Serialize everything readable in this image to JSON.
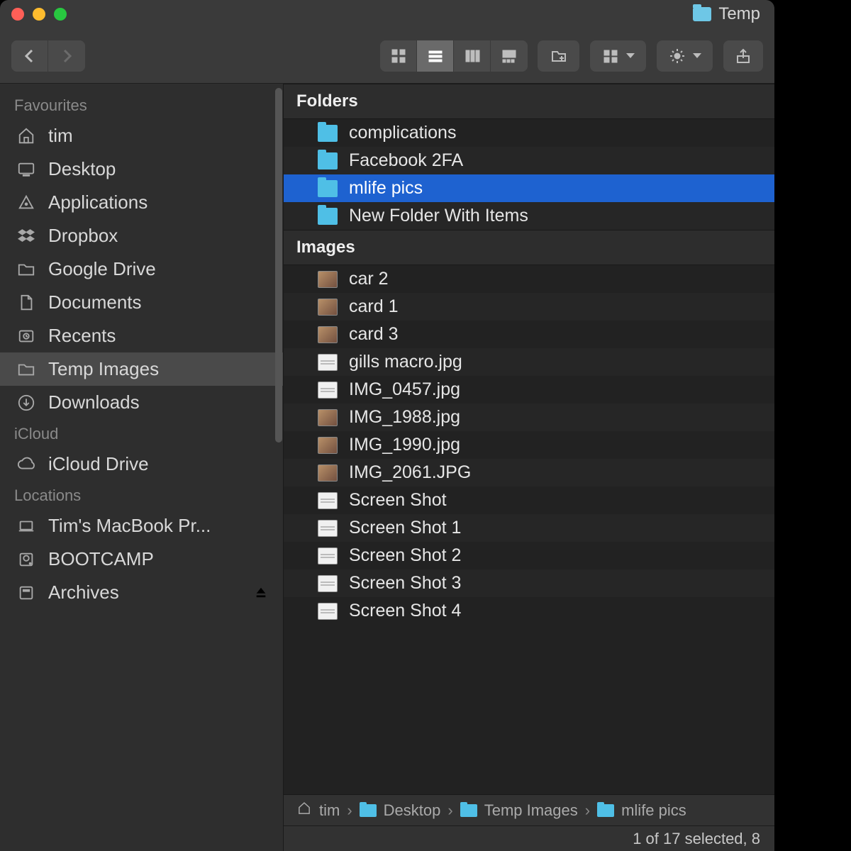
{
  "title": {
    "folder_name": "Temp"
  },
  "sidebar": {
    "sections": [
      {
        "header": "Favourites",
        "items": [
          {
            "label": "tim",
            "icon": "home"
          },
          {
            "label": "Desktop",
            "icon": "desktop"
          },
          {
            "label": "Applications",
            "icon": "apps"
          },
          {
            "label": "Dropbox",
            "icon": "dropbox"
          },
          {
            "label": "Google Drive",
            "icon": "folder"
          },
          {
            "label": "Documents",
            "icon": "document"
          },
          {
            "label": "Recents",
            "icon": "recents"
          },
          {
            "label": "Temp Images",
            "icon": "folder",
            "selected": true
          },
          {
            "label": "Downloads",
            "icon": "downloads"
          }
        ]
      },
      {
        "header": "iCloud",
        "items": [
          {
            "label": "iCloud Drive",
            "icon": "cloud"
          }
        ]
      },
      {
        "header": "Locations",
        "items": [
          {
            "label": "Tim's MacBook Pr...",
            "icon": "laptop"
          },
          {
            "label": "BOOTCAMP",
            "icon": "hdd"
          },
          {
            "label": "Archives",
            "icon": "ext",
            "eject": true
          }
        ]
      }
    ]
  },
  "main": {
    "groups": [
      {
        "header": "Folders",
        "rows": [
          {
            "name": "complications",
            "kind": "folder"
          },
          {
            "name": "Facebook 2FA",
            "kind": "folder"
          },
          {
            "name": "mlife pics",
            "kind": "folder",
            "selected": true
          },
          {
            "name": "New Folder With Items",
            "kind": "folder"
          }
        ]
      },
      {
        "header": "Images",
        "rows": [
          {
            "name": "car 2",
            "kind": "img"
          },
          {
            "name": "card 1",
            "kind": "img"
          },
          {
            "name": "card 3",
            "kind": "img"
          },
          {
            "name": "gills macro.jpg",
            "kind": "white"
          },
          {
            "name": "IMG_0457.jpg",
            "kind": "white"
          },
          {
            "name": "IMG_1988.jpg",
            "kind": "img"
          },
          {
            "name": "IMG_1990.jpg",
            "kind": "img"
          },
          {
            "name": "IMG_2061.JPG",
            "kind": "img"
          },
          {
            "name": "Screen Shot",
            "kind": "white"
          },
          {
            "name": "Screen Shot 1",
            "kind": "white"
          },
          {
            "name": "Screen Shot 2",
            "kind": "white"
          },
          {
            "name": "Screen Shot 3",
            "kind": "white"
          },
          {
            "name": "Screen Shot 4",
            "kind": "white"
          }
        ]
      }
    ]
  },
  "pathbar": {
    "segments": [
      {
        "label": "tim",
        "icon": "home"
      },
      {
        "label": "Desktop",
        "icon": "folder"
      },
      {
        "label": "Temp Images",
        "icon": "folder"
      },
      {
        "label": "mlife pics",
        "icon": "folder"
      }
    ]
  },
  "status": {
    "text": "1 of 17 selected, 8"
  }
}
